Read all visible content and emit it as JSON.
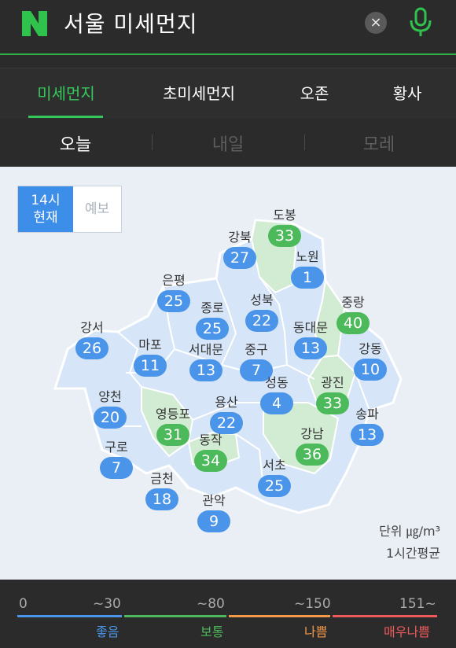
{
  "search": {
    "query": "서울 미세먼지",
    "logo_letter": "N",
    "clear_label": "×"
  },
  "tabs": [
    {
      "label": "미세먼지",
      "active": true
    },
    {
      "label": "초미세먼지",
      "active": false
    },
    {
      "label": "오존",
      "active": false
    },
    {
      "label": "황사",
      "active": false
    }
  ],
  "days": [
    {
      "label": "오늘",
      "active": true
    },
    {
      "label": "내일",
      "active": false
    },
    {
      "label": "모레",
      "active": false
    }
  ],
  "toggle": {
    "now_line1": "14시",
    "now_line2": "현재",
    "forecast": "예보"
  },
  "districts": [
    {
      "name": "도봉",
      "value": "33",
      "level": "mod"
    },
    {
      "name": "강북",
      "value": "27",
      "level": "good"
    },
    {
      "name": "노원",
      "value": "1",
      "level": "good"
    },
    {
      "name": "은평",
      "value": "25",
      "level": "good"
    },
    {
      "name": "성북",
      "value": "22",
      "level": "good"
    },
    {
      "name": "중랑",
      "value": "40",
      "level": "mod"
    },
    {
      "name": "종로",
      "value": "25",
      "level": "good"
    },
    {
      "name": "동대문",
      "value": "13",
      "level": "good"
    },
    {
      "name": "강서",
      "value": "26",
      "level": "good"
    },
    {
      "name": "마포",
      "value": "11",
      "level": "good"
    },
    {
      "name": "서대문",
      "value": "13",
      "level": "good"
    },
    {
      "name": "중구",
      "value": "7",
      "level": "good"
    },
    {
      "name": "강동",
      "value": "10",
      "level": "good"
    },
    {
      "name": "성동",
      "value": "4",
      "level": "good"
    },
    {
      "name": "광진",
      "value": "33",
      "level": "mod"
    },
    {
      "name": "양천",
      "value": "20",
      "level": "good"
    },
    {
      "name": "용산",
      "value": "22",
      "level": "good"
    },
    {
      "name": "영등포",
      "value": "31",
      "level": "mod"
    },
    {
      "name": "송파",
      "value": "13",
      "level": "good"
    },
    {
      "name": "동작",
      "value": "34",
      "level": "mod"
    },
    {
      "name": "강남",
      "value": "36",
      "level": "mod"
    },
    {
      "name": "구로",
      "value": "7",
      "level": "good"
    },
    {
      "name": "서초",
      "value": "25",
      "level": "good"
    },
    {
      "name": "금천",
      "value": "18",
      "level": "good"
    },
    {
      "name": "관악",
      "value": "9",
      "level": "good"
    }
  ],
  "unit": {
    "line1": "단위 ㎍/m³",
    "line2": "1시간평균"
  },
  "legend": [
    {
      "range_start": "0",
      "range_end": "~30",
      "label": "좋음",
      "color": "#4a95ea"
    },
    {
      "range_end": "~80",
      "label": "보통",
      "color": "#4cba5a"
    },
    {
      "range_end": "~150",
      "label": "나쁨",
      "color": "#f39a4a"
    },
    {
      "range_end": "151~",
      "label": "매우나쁨",
      "color": "#ee5a5a"
    }
  ],
  "colors": {
    "accent": "#34c85a",
    "good": "#4a95ea",
    "moderate": "#4cba5a",
    "map_good": "#d6e6f8",
    "map_mod": "#d2ecd4"
  }
}
